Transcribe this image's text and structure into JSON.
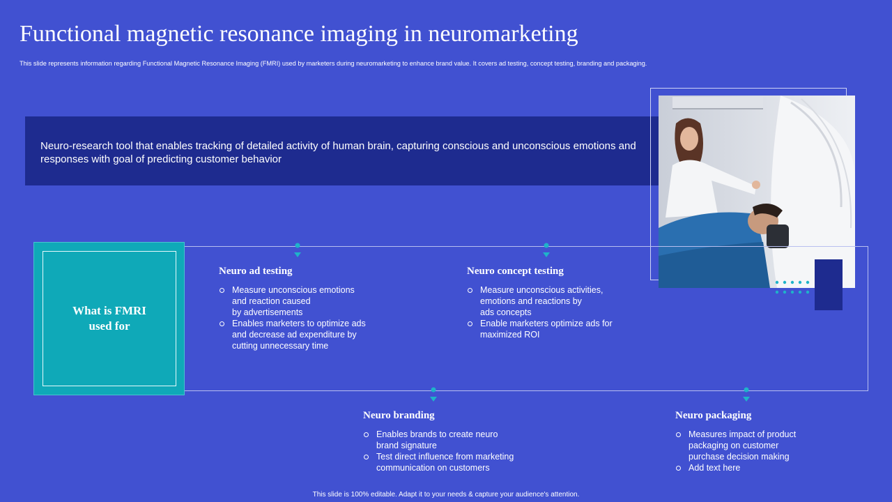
{
  "header": {
    "title": "Functional magnetic resonance imaging in neuromarketing",
    "subtitle": "This slide represents information regarding Functional Magnetic Resonance Imaging  (FMRI)  used by marketers during neuromarketing to enhance brand value. It covers ad testing, concept testing, branding and packaging."
  },
  "definition": {
    "text": "Neuro-research tool that enables tracking of detailed activity of human brain, capturing conscious and unconscious emotions and responses with goal of predicting customer behavior"
  },
  "center": {
    "label": "What is FMRI used for"
  },
  "sections": [
    {
      "title": "Neuro ad testing",
      "items": [
        "Measure unconscious emotions\nand reaction caused\nby advertisements",
        "Enables marketers to optimize ads\nand decrease ad expenditure  by\ncutting unnecessary time"
      ]
    },
    {
      "title": "Neuro concept testing",
      "items": [
        "Measure unconscious activities,\nemotions and reactions by\nads concepts",
        "Enable marketers optimize ads for\nmaximized ROI"
      ]
    },
    {
      "title": "Neuro branding",
      "items": [
        "Enables brands  to create neuro\nbrand signature",
        "Test direct influence from marketing\ncommunication on customers"
      ]
    },
    {
      "title": "Neuro packaging",
      "items": [
        "Measures impact of product\npackaging on customer\npurchase decision making",
        "Add text here"
      ]
    }
  ],
  "footer": {
    "text": "This slide is 100% editable.  Adapt it to your needs & capture your audience's attention."
  },
  "colors": {
    "background": "#4151d1",
    "dark_blue": "#1e2b8f",
    "teal": "#0fa9b8",
    "marker": "#1fb3c9"
  }
}
